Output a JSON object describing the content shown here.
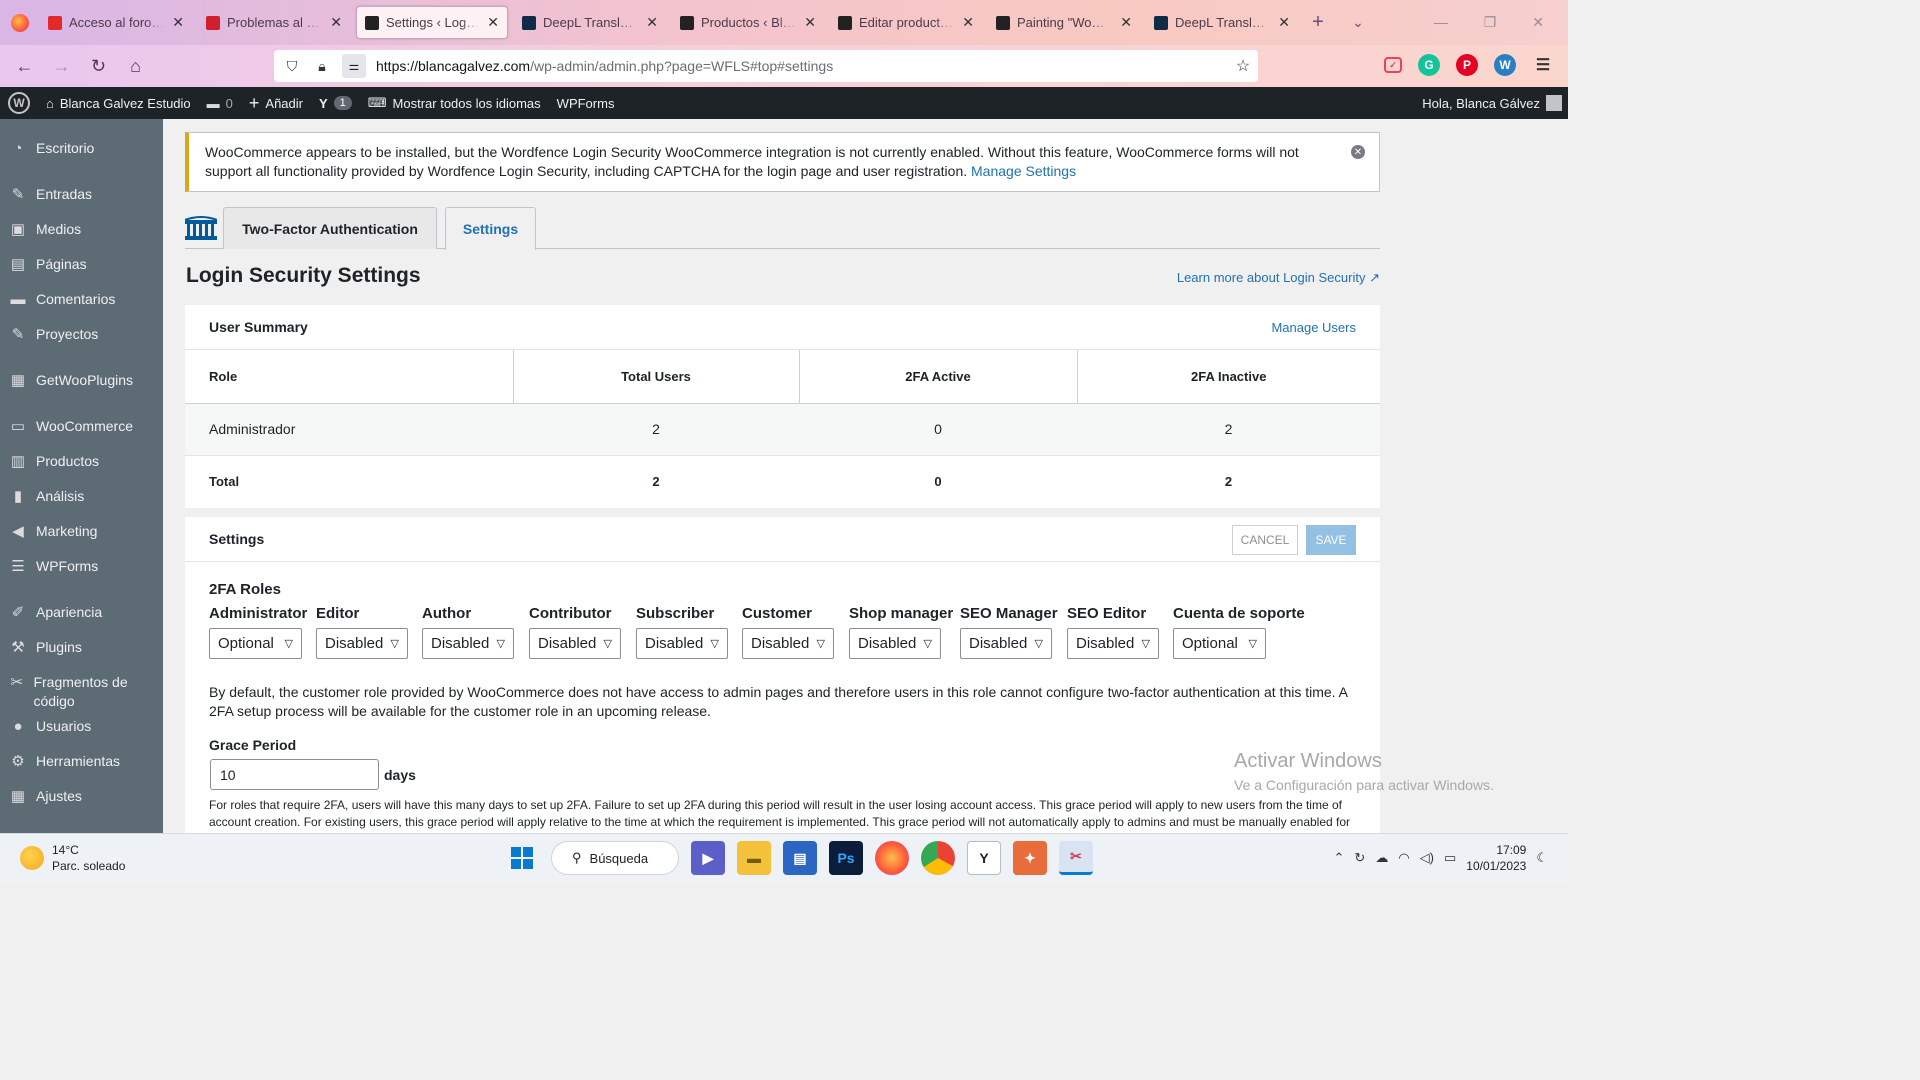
{
  "browser": {
    "tabs": [
      {
        "title": "Acceso al foro - WordPress",
        "favicon_color": "#e4292a",
        "active": false
      },
      {
        "title": "Problemas al añadir",
        "favicon_color": "#d01f2f",
        "active": false
      },
      {
        "title": "Settings ‹ Login Security",
        "favicon_color": "#222222",
        "active": true
      },
      {
        "title": "DeepL Translate - El",
        "favicon_color": "#0f2b46",
        "active": false
      },
      {
        "title": "Productos ‹ Blanca",
        "favicon_color": "#222222",
        "active": false
      },
      {
        "title": "Editar producto «Pa",
        "favicon_color": "#222222",
        "active": false
      },
      {
        "title": "Painting \"Woman an",
        "favicon_color": "#222222",
        "active": false
      },
      {
        "title": "DeepL Translate - El",
        "favicon_color": "#0f2b46",
        "active": false
      }
    ],
    "url_host": "https://blancagalvez.com",
    "url_path": "/wp-admin/admin.php?page=WFLS#top#settings"
  },
  "adminbar": {
    "site": "Blanca Galvez Estudio",
    "comments": "0",
    "add": "Añadir",
    "yoast_count": "1",
    "languages": "Mostrar todos los idiomas",
    "wpforms": "WPForms",
    "greeting": "Hola, Blanca Gálvez"
  },
  "sidebar": {
    "items": [
      {
        "label": "Escritorio",
        "icon": "dashboard-icon",
        "glyph": "◔"
      },
      {
        "label": "Entradas",
        "icon": "pin-icon",
        "glyph": "✎"
      },
      {
        "label": "Medios",
        "icon": "media-icon",
        "glyph": "▣"
      },
      {
        "label": "Páginas",
        "icon": "pages-icon",
        "glyph": "▤"
      },
      {
        "label": "Comentarios",
        "icon": "comments-icon",
        "glyph": "▬"
      },
      {
        "label": "Proyectos",
        "icon": "pin-icon",
        "glyph": "✎"
      },
      {
        "label": "GetWooPlugins",
        "icon": "plugin-grid-icon",
        "glyph": "▦"
      },
      {
        "label": "WooCommerce",
        "icon": "woo-icon",
        "glyph": "▭"
      },
      {
        "label": "Productos",
        "icon": "archive-icon",
        "glyph": "▥"
      },
      {
        "label": "Análisis",
        "icon": "chart-icon",
        "glyph": "▮"
      },
      {
        "label": "Marketing",
        "icon": "megaphone-icon",
        "glyph": "◀"
      },
      {
        "label": "WPForms",
        "icon": "forms-icon",
        "glyph": "☰"
      },
      {
        "label": "Apariencia",
        "icon": "brush-icon",
        "glyph": "✐"
      },
      {
        "label": "Plugins",
        "icon": "plugin-icon",
        "glyph": "⚒"
      },
      {
        "label": "Fragmentos de código",
        "icon": "scissors-icon",
        "glyph": "✂"
      },
      {
        "label": "Usuarios",
        "icon": "user-icon",
        "glyph": "●"
      },
      {
        "label": "Herramientas",
        "icon": "wrench-icon",
        "glyph": "⚙"
      },
      {
        "label": "Ajustes",
        "icon": "settings-icon",
        "glyph": "▦"
      }
    ]
  },
  "notice": {
    "text": "WooCommerce appears to be installed, but the Wordfence Login Security WooCommerce integration is not currently enabled. Without this feature, WooCommerce forms will not support all functionality provided by Wordfence Login Security, including CAPTCHA for the login page and user registration.",
    "link": "Manage Settings"
  },
  "tabs": {
    "two_factor": "Two-Factor Authentication",
    "settings": "Settings"
  },
  "page": {
    "title": "Login Security Settings",
    "learn_more": "Learn more about Login Security"
  },
  "summary": {
    "title": "User Summary",
    "manage_users": "Manage Users",
    "headers": [
      "Role",
      "Total Users",
      "2FA Active",
      "2FA Inactive"
    ],
    "rows": [
      [
        "Administrador",
        "2",
        "0",
        "2"
      ]
    ],
    "total": [
      "Total",
      "2",
      "0",
      "2"
    ]
  },
  "settings": {
    "title": "Settings",
    "cancel": "CANCEL",
    "save": "SAVE",
    "roles_title": "2FA Roles",
    "roles": [
      {
        "name": "Administrator",
        "value": "Optional"
      },
      {
        "name": "Editor",
        "value": "Disabled"
      },
      {
        "name": "Author",
        "value": "Disabled"
      },
      {
        "name": "Contributor",
        "value": "Disabled"
      },
      {
        "name": "Subscriber",
        "value": "Disabled"
      },
      {
        "name": "Customer",
        "value": "Disabled"
      },
      {
        "name": "Shop manager",
        "value": "Disabled"
      },
      {
        "name": "SEO Manager",
        "value": "Disabled"
      },
      {
        "name": "SEO Editor",
        "value": "Disabled"
      },
      {
        "name": "Cuenta de soporte",
        "value": "Optional"
      }
    ],
    "customer_info": "By default, the customer role provided by WooCommerce does not have access to admin pages and therefore users in this role cannot configure two-factor authentication at this time. A 2FA setup process will be available for the customer role in an upcoming release.",
    "grace_label": "Grace Period",
    "grace_value": "10",
    "grace_unit": "days",
    "grace_help": "For roles that require 2FA, users will have this many days to set up 2FA. Failure to set up 2FA during this period will result in the user losing account access. This grace period will apply to new users from the time of account creation. For existing users, this grace period will apply relative to the time at which the requirement is implemented. This grace period will not automatically apply to admins and must be manually enabled for each admin."
  },
  "watermark": {
    "line1": "Activar Windows",
    "line2": "Ve a Configuración para activar Windows."
  },
  "taskbar": {
    "temp": "14°C",
    "weather": "Parc. soleado",
    "search": "Búsqueda",
    "time": "17:09",
    "date": "10/01/2023"
  }
}
